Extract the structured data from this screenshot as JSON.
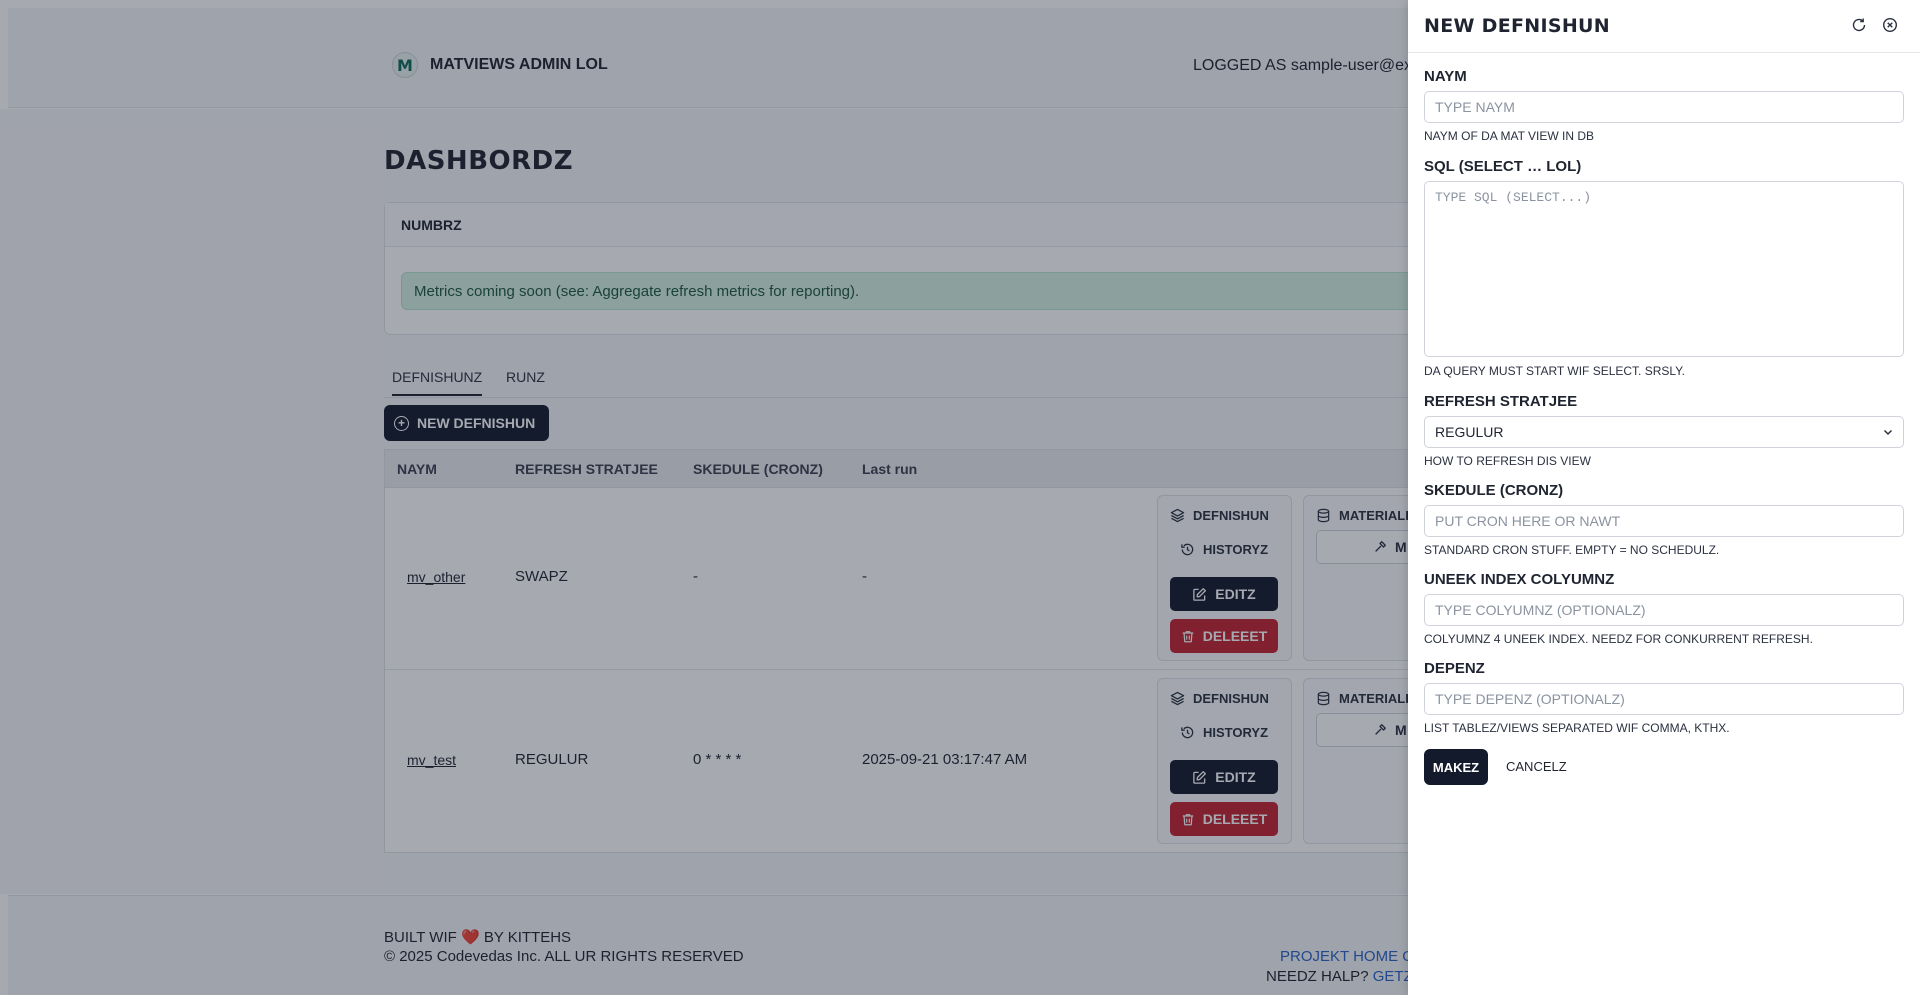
{
  "app": {
    "brand_name": "MATVIEWS ADMIN LOL",
    "logged_as": "LOGGED AS sample-user@exam"
  },
  "page": {
    "title": "DASHBORDZ"
  },
  "metrics_card": {
    "title": "NUMBRZ",
    "alert": "Metrics coming soon (see: Aggregate refresh metrics for reporting)."
  },
  "tabs": [
    {
      "label": "DEFNISHUNZ",
      "active": true
    },
    {
      "label": "RUNZ",
      "active": false
    }
  ],
  "new_button_label": "NEW DEFNISHUN",
  "table": {
    "headers": [
      "NAYM",
      "REFRESH STRATJEE",
      "SKEDULE (CRONZ)",
      "Last run"
    ],
    "rows": [
      {
        "name": "mv_other",
        "strategy": "SWAPZ",
        "schedule": "-",
        "last_run": "-"
      },
      {
        "name": "mv_test",
        "strategy": "REGULUR",
        "schedule": "0 * * * *",
        "last_run": "2025-09-21 03:17:47 AM"
      }
    ],
    "actions": {
      "definition": "DEFNISHUN",
      "history": "HISTORYZ",
      "edit": "EDITZ",
      "delete": "DELEEET",
      "materialize": "MATERIALIZ",
      "materialize_btn": "M"
    }
  },
  "footer": {
    "built_prefix": "BUILT WIF",
    "heart": "❤️",
    "built_suffix": "BY KITTEHS",
    "copyright": "© 2025 Codevedas Inc. ALL UR RIGHTS RESERVED",
    "project_link": "PROJEKT HOME O",
    "help_text": "NEEDZ HALP?",
    "help_link": "GETZ"
  },
  "drawer": {
    "title": "NEW DEFNISHUN",
    "fields": {
      "name": {
        "label": "NAYM",
        "placeholder": "TYPE NAYM",
        "help": "NAYM OF DA MAT VIEW IN DB"
      },
      "sql": {
        "label": "SQL (SELECT … LOL)",
        "placeholder": "TYPE SQL (SELECT...)",
        "help": "DA QUERY MUST START WIF SELECT. SRSLY."
      },
      "strategy": {
        "label": "REFRESH STRATJEE",
        "value": "REGULUR",
        "help": "HOW TO REFRESH DIS VIEW"
      },
      "schedule": {
        "label": "SKEDULE (CRONZ)",
        "placeholder": "PUT CRON HERE OR NAWT",
        "help": "STANDARD CRON STUFF. EMPTY = NO SCHEDULZ."
      },
      "unique_index": {
        "label": "UNEEK INDEX COLYUMNZ",
        "placeholder": "TYPE COLYUMNZ (OPTIONALZ)",
        "help": "COLYUMNZ 4 UNEEK INDEX. NEEDZ FOR CONKURRENT REFRESH."
      },
      "depends": {
        "label": "DEPENZ",
        "placeholder": "TYPE DEPENZ (OPTIONALZ)",
        "help": "LIST TABLEZ/VIEWS SEPARATED WIF COMMA, KTHX."
      }
    },
    "submit_label": "MAKEZ",
    "cancel_label": "CANCELZ"
  },
  "colors": {
    "primary": "#121a2b",
    "danger": "#c4232f",
    "alert_bg": "#d6f1e2",
    "link": "#2a63c9"
  }
}
